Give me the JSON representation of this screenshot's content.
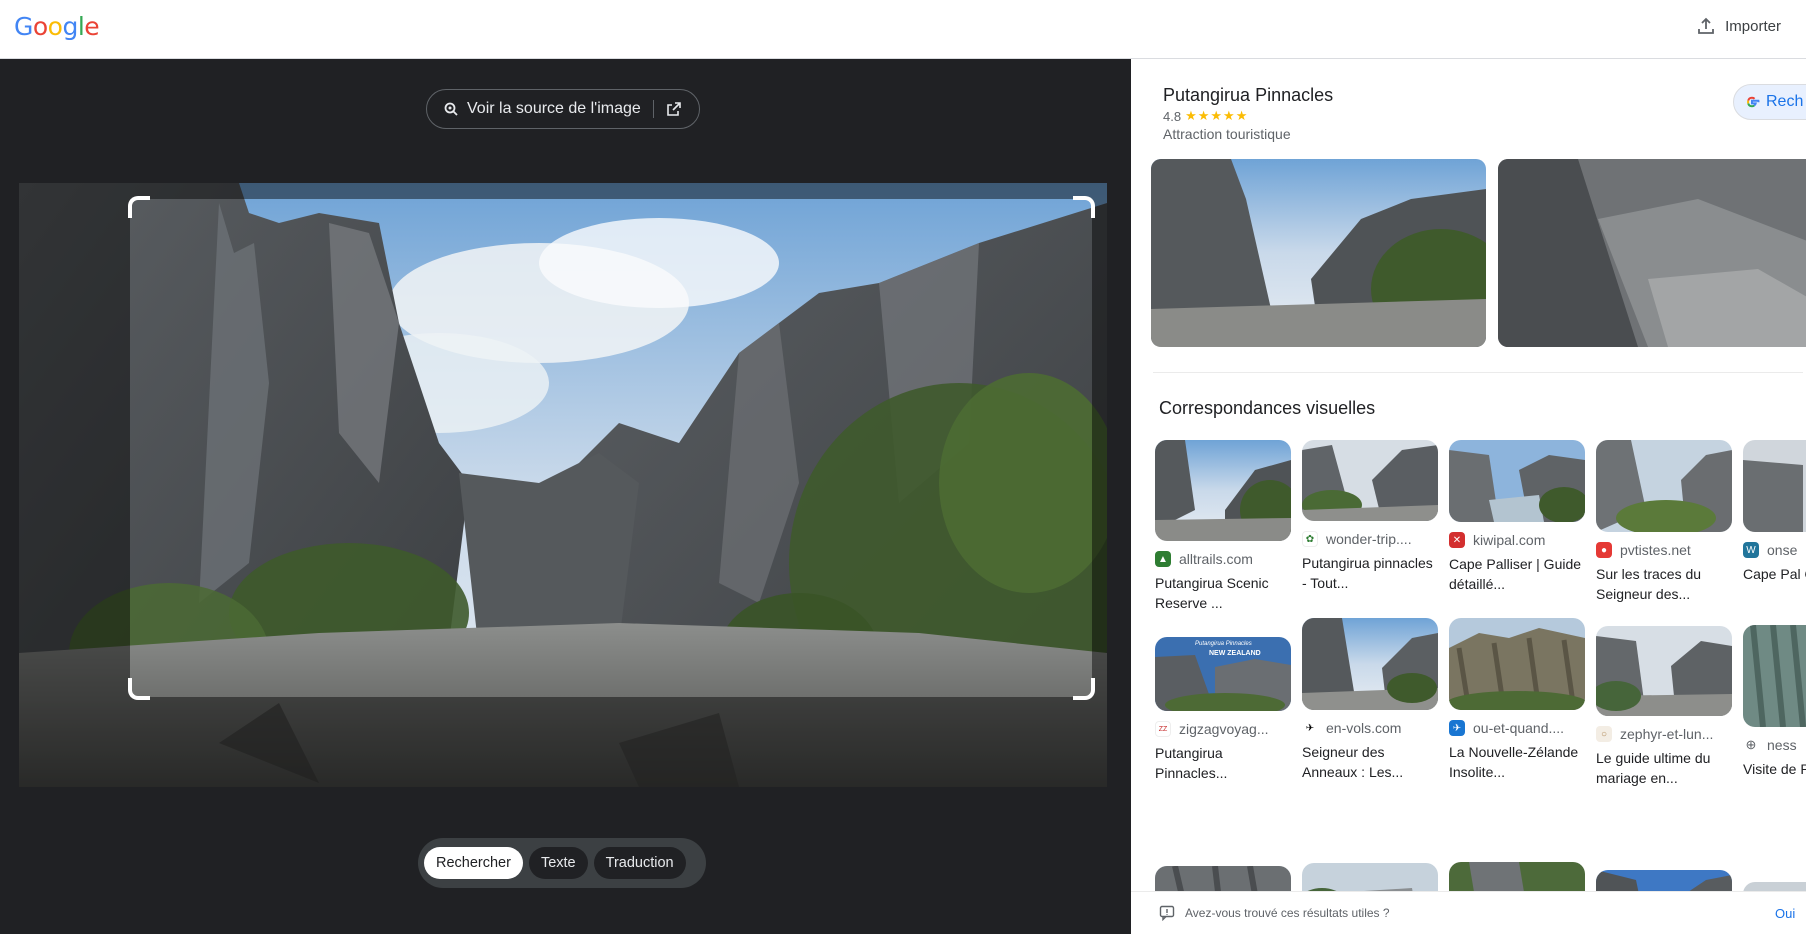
{
  "header": {
    "logo_letters": [
      "G",
      "o",
      "o",
      "g",
      "l",
      "e"
    ],
    "import_label": "Importer"
  },
  "left": {
    "source_button_label": "Voir la source de l'image",
    "modes": [
      "Rechercher",
      "Texte",
      "Traduction"
    ],
    "active_mode": "Rechercher"
  },
  "knowledge_panel": {
    "title": "Putangirua Pinnacles",
    "rating": "4.8",
    "stars": "★★★★★",
    "category": "Attraction touristique",
    "search_button_label": "Rech"
  },
  "visual_matches": {
    "title": "Correspondances visuelles",
    "columns": [
      [
        {
          "site": "alltrails.com",
          "caption": "Putangirua Scenic Reserve ..."
        },
        {
          "site": "zigzagvoyag...",
          "caption": "Putangirua Pinnacles..."
        }
      ],
      [
        {
          "site": "wonder-trip....",
          "caption": "Putangirua pinnacles - Tout..."
        },
        {
          "site": "en-vols.com",
          "caption": "Seigneur des Anneaux : Les..."
        }
      ],
      [
        {
          "site": "kiwipal.com",
          "caption": "Cape Palliser | Guide détaillé..."
        },
        {
          "site": "ou-et-quand....",
          "caption": "La Nouvelle-Zélande Insolite..."
        }
      ],
      [
        {
          "site": "pvtistes.net",
          "caption": "Sur les traces du Seigneur des..."
        },
        {
          "site": "zephyr-et-lun...",
          "caption": "Le guide ultime du mariage en..."
        }
      ],
      [
        {
          "site": "onse",
          "caption": "Cape Pal On se ca"
        },
        {
          "site": "ness",
          "caption": "Visite de Putangir"
        }
      ]
    ],
    "thumb_overlay_text": [
      "Putangirua Pinnacles",
      "NEW ZEALAND"
    ]
  },
  "feedback": {
    "question": "Avez-vous trouvé ces résultats utiles ?",
    "yes_label": "Oui"
  },
  "colors": {
    "google_blue": "#4285F4",
    "google_red": "#EA4335",
    "google_yellow": "#FBBC05",
    "google_green": "#34A853",
    "dark_bg": "#202124",
    "link_blue": "#1a73e8"
  }
}
